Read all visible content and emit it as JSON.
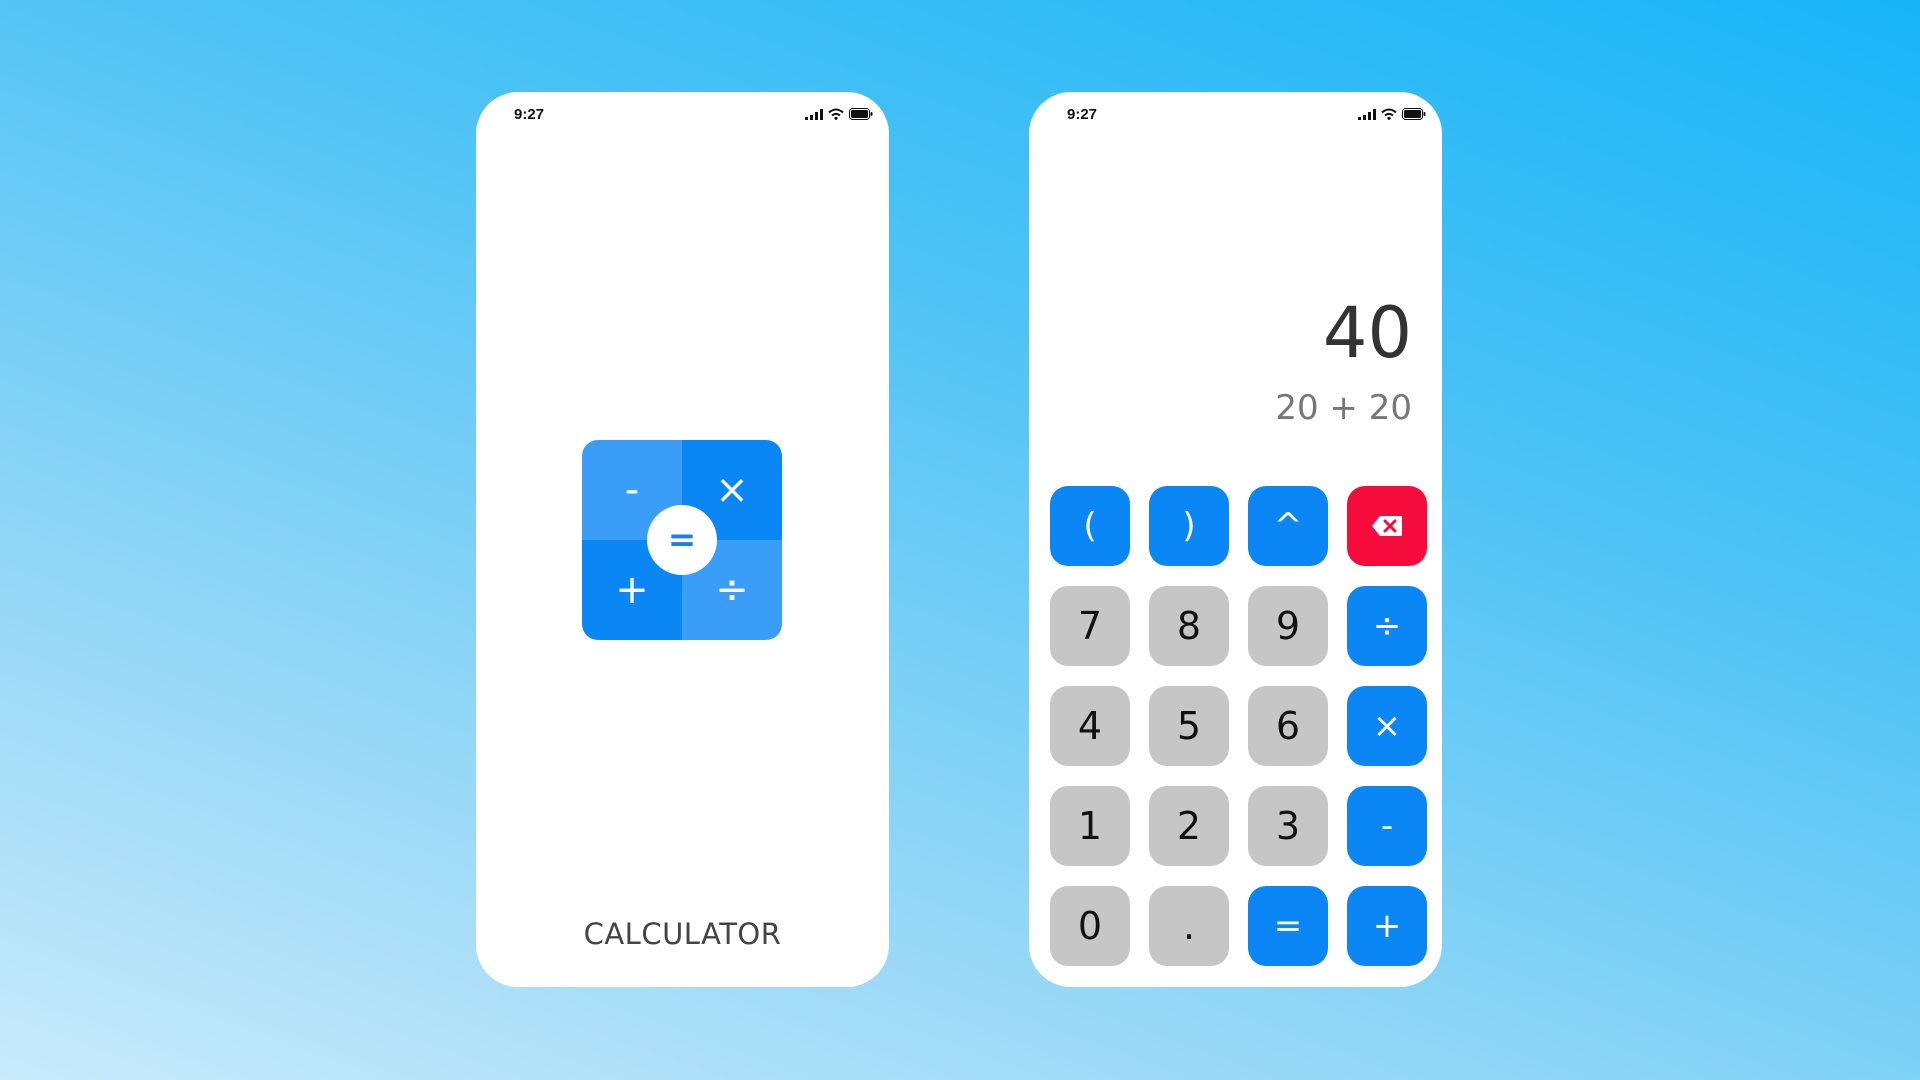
{
  "colors": {
    "accent": "#0a86f5",
    "accent_light": "#3a9ef9",
    "number_key": "#c6c6c6",
    "delete_key": "#f50c3c",
    "background_top": "#18b5f8",
    "background_bottom": "#c8eafb"
  },
  "splash_screen": {
    "status_time": "9:27",
    "status_icons": [
      "signal-icon",
      "wifi-icon",
      "battery-icon"
    ],
    "logo": {
      "top_left": "-",
      "top_right": "×",
      "bottom_left": "+",
      "bottom_right": "÷",
      "center": "="
    },
    "title": "CALCULATOR"
  },
  "calculator_screen": {
    "status_time": "9:27",
    "status_icons": [
      "signal-icon",
      "wifi-icon",
      "battery-icon"
    ],
    "display": {
      "result": "40",
      "expression": "20 + 20"
    },
    "keys": [
      {
        "label": "(",
        "type": "op",
        "name": "open-paren-key"
      },
      {
        "label": ")",
        "type": "op",
        "name": "close-paren-key"
      },
      {
        "label": "^",
        "type": "op",
        "name": "power-key"
      },
      {
        "label": "",
        "type": "del",
        "name": "backspace-key",
        "icon": "backspace-icon"
      },
      {
        "label": "7",
        "type": "num",
        "name": "digit-7-key"
      },
      {
        "label": "8",
        "type": "num",
        "name": "digit-8-key"
      },
      {
        "label": "9",
        "type": "num",
        "name": "digit-9-key"
      },
      {
        "label": "÷",
        "type": "op",
        "name": "divide-key"
      },
      {
        "label": "4",
        "type": "num",
        "name": "digit-4-key"
      },
      {
        "label": "5",
        "type": "num",
        "name": "digit-5-key"
      },
      {
        "label": "6",
        "type": "num",
        "name": "digit-6-key"
      },
      {
        "label": "×",
        "type": "op",
        "name": "multiply-key"
      },
      {
        "label": "1",
        "type": "num",
        "name": "digit-1-key"
      },
      {
        "label": "2",
        "type": "num",
        "name": "digit-2-key"
      },
      {
        "label": "3",
        "type": "num",
        "name": "digit-3-key"
      },
      {
        "label": "-",
        "type": "op",
        "name": "subtract-key"
      },
      {
        "label": "0",
        "type": "num",
        "name": "digit-0-key"
      },
      {
        "label": ".",
        "type": "num",
        "name": "decimal-key"
      },
      {
        "label": "=",
        "type": "op",
        "name": "equals-key"
      },
      {
        "label": "+",
        "type": "op",
        "name": "add-key"
      }
    ]
  }
}
